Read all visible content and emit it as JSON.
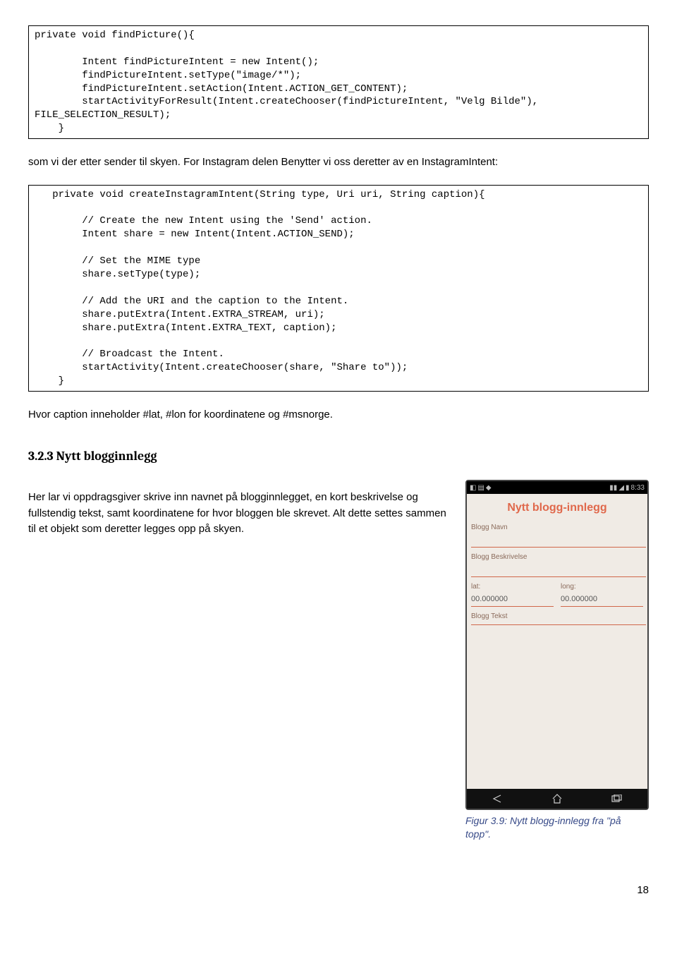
{
  "code_block_1": "private void findPicture(){\n\n        Intent findPictureIntent = new Intent();\n        findPictureIntent.setType(\"image/*\");\n        findPictureIntent.setAction(Intent.ACTION_GET_CONTENT);\n        startActivityForResult(Intent.createChooser(findPictureIntent, \"Velg Bilde\"),\nFILE_SELECTION_RESULT);\n    }",
  "paragraph_1": "som vi der etter sender til skyen. For Instagram delen Benytter vi oss deretter av en InstagramIntent:",
  "code_block_2": "   private void createInstagramIntent(String type, Uri uri, String caption){\n\n        // Create the new Intent using the 'Send' action.\n        Intent share = new Intent(Intent.ACTION_SEND);\n\n        // Set the MIME type\n        share.setType(type);\n\n        // Add the URI and the caption to the Intent.\n        share.putExtra(Intent.EXTRA_STREAM, uri);\n        share.putExtra(Intent.EXTRA_TEXT, caption);\n\n        // Broadcast the Intent.\n        startActivity(Intent.createChooser(share, \"Share to\"));\n    }",
  "paragraph_2": "Hvor caption inneholder #lat, #lon for koordinatene og #msnorge.",
  "section_heading": "3.2.3 Nytt blogginnlegg",
  "paragraph_3": "Her lar vi oppdragsgiver skrive inn navnet på blogginnlegget, en kort beskrivelse og fullstendig tekst, samt koordinatene for hvor bloggen ble skrevet. Alt dette settes sammen til et objekt som deretter legges opp på skyen.",
  "phone": {
    "status_time": "8:33",
    "screen_title": "Nytt blogg-innlegg",
    "label_name": "Blogg Navn",
    "label_desc": "Blogg Beskrivelse",
    "label_lat": "lat:",
    "label_long": "long:",
    "val_lat": "00.000000",
    "val_long": "00.000000",
    "label_text": "Blogg Tekst"
  },
  "figure_caption": "Figur 3.9: Nytt blogg-innlegg fra \"på topp\".",
  "page_number": "18"
}
